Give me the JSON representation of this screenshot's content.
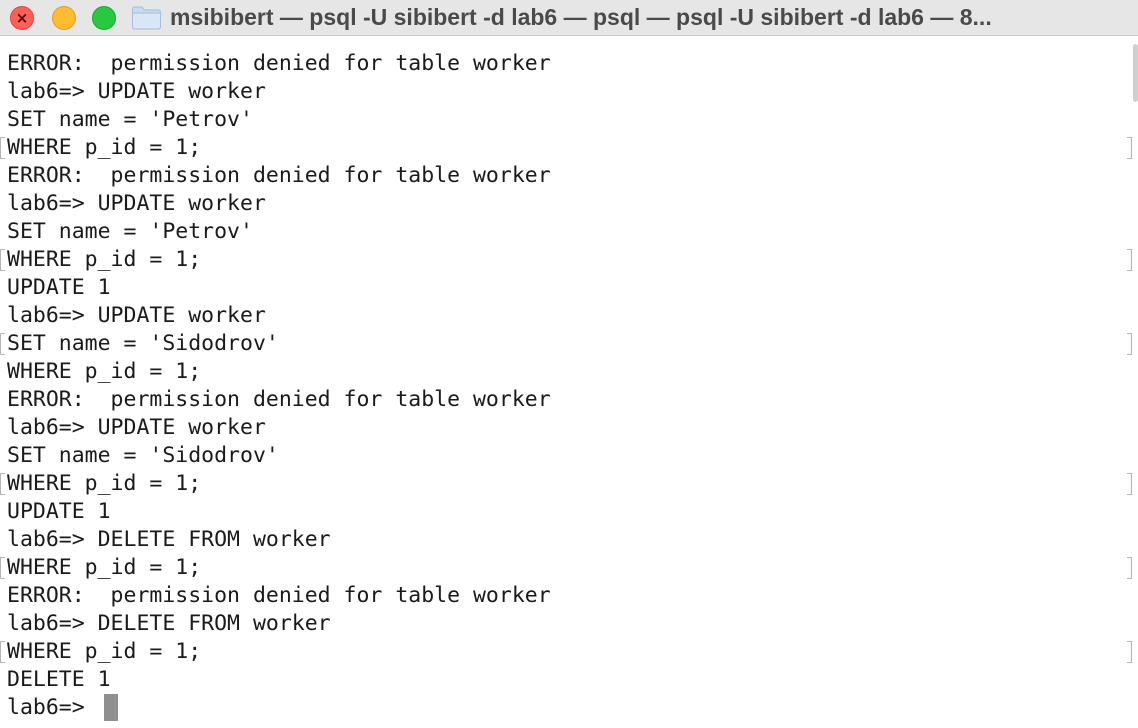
{
  "window": {
    "title": "msibibert — psql -U sibibert -d lab6 — psql — psql -U sibibert -d lab6 — 8..."
  },
  "terminal": {
    "lines": [
      "ERROR:  permission denied for table worker",
      "lab6=> UPDATE worker",
      "SET name = 'Petrov'",
      "WHERE p_id = 1;",
      "ERROR:  permission denied for table worker",
      "lab6=> UPDATE worker",
      "SET name = 'Petrov'",
      "WHERE p_id = 1;",
      "UPDATE 1",
      "lab6=> UPDATE worker",
      "SET name = 'Sidodrov'",
      "WHERE p_id = 1;",
      "ERROR:  permission denied for table worker",
      "lab6=> UPDATE worker",
      "SET name = 'Sidodrov'",
      "WHERE p_id = 1;",
      "UPDATE 1",
      "lab6=> DELETE FROM worker",
      "WHERE p_id = 1;",
      "ERROR:  permission denied for table worker",
      "lab6=> DELETE FROM worker",
      "WHERE p_id = 1;",
      "DELETE 1",
      "lab6=> "
    ]
  },
  "colors": {
    "titlebar": "#e6e6e6",
    "close": "#fe5f57",
    "minimize": "#febc2e",
    "maximize": "#28c840",
    "text": "#1a1a1a",
    "cursor": "#8f8f8f"
  },
  "icons": {
    "folder": "folder-icon",
    "close": "close-icon"
  }
}
